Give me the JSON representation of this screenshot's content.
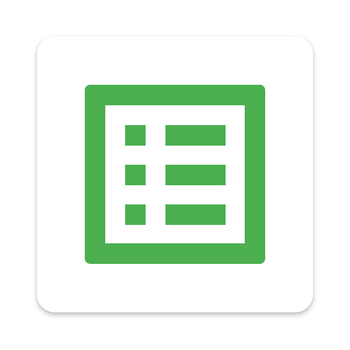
{
  "app_icon": {
    "icon_name": "list-form-icon",
    "rows": 3,
    "colors": {
      "tile": "#ffffff",
      "accent": "#4caf50"
    }
  }
}
